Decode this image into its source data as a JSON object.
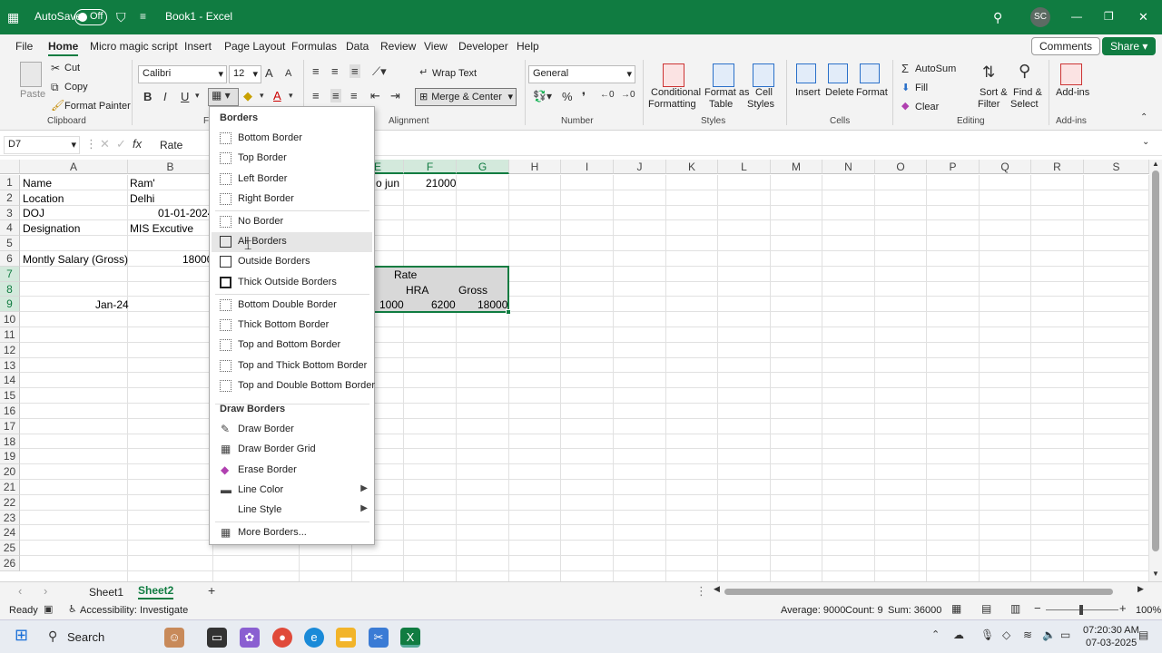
{
  "titlebar": {
    "autosave": "AutoSave",
    "autosave_state": "Off",
    "doc_title": "Book1 - Excel",
    "user_initials": "SC"
  },
  "menu": {
    "tabs": [
      "File",
      "Home",
      "Micro magic script",
      "Insert",
      "Page Layout",
      "Formulas",
      "Data",
      "Review",
      "View",
      "Developer",
      "Help"
    ],
    "comments": "Comments",
    "share": "Share"
  },
  "ribbon": {
    "cut": "Cut",
    "copy": "Copy",
    "format_painter": "Format Painter",
    "paste": "Paste",
    "clipboard": "Clipboard",
    "font_name": "Calibri",
    "font_size": "12",
    "font_group": "F",
    "wrap_text": "Wrap Text",
    "merge_center": "Merge & Center",
    "alignment": "Alignment",
    "number_format": "General",
    "number": "Number",
    "cond_fmt_1": "Conditional",
    "cond_fmt_2": "Formatting",
    "format_table_1": "Format as",
    "format_table_2": "Table",
    "cell_styles_1": "Cell",
    "cell_styles_2": "Styles",
    "styles": "Styles",
    "insert": "Insert",
    "delete": "Delete",
    "format": "Format",
    "cells": "Cells",
    "autosum": "AutoSum",
    "fill": "Fill",
    "clear": "Clear",
    "sort_1": "Sort &",
    "sort_2": "Filter",
    "find_1": "Find &",
    "find_2": "Select",
    "editing": "Editing",
    "addins": "Add-ins",
    "addins_group": "Add-ins"
  },
  "formula": {
    "namebox": "D7",
    "fx": "fx",
    "content": "Rate"
  },
  "columns": [
    "A",
    "B",
    "C",
    "D",
    "E",
    "F",
    "G",
    "H",
    "I",
    "J",
    "K",
    "L",
    "M",
    "N",
    "O",
    "P",
    "Q",
    "R",
    "S"
  ],
  "rows": [
    "1",
    "2",
    "3",
    "4",
    "5",
    "6",
    "7",
    "8",
    "9",
    "10",
    "11",
    "12",
    "13",
    "14",
    "15",
    "16",
    "17",
    "18",
    "19",
    "20",
    "21",
    "22",
    "23",
    "24",
    "25",
    "26"
  ],
  "cells": {
    "a1": "Name",
    "b1": "Ram'",
    "a2": "Location",
    "b2": "Delhi",
    "a3": "DOJ",
    "b3": "01-01-2024",
    "a4": "Designation",
    "b4": "MIS Excutive",
    "a6": "Montly Salary (Gross)",
    "b6": "18000",
    "a9": "Jan-24",
    "e1": "o jun",
    "f1": "21000",
    "rate": "Rate",
    "hra": "HRA",
    "gross": "Gross",
    "e9": "1000",
    "f9": "6200",
    "g9": "18000"
  },
  "borders_menu": {
    "header": "Borders",
    "items": [
      "Bottom Border",
      "Top Border",
      "Left Border",
      "Right Border",
      "No Border",
      "All Borders",
      "Outside Borders",
      "Thick Outside Borders",
      "Bottom Double Border",
      "Thick Bottom Border",
      "Top and Bottom Border",
      "Top and Thick Bottom Border",
      "Top and Double Bottom Border"
    ],
    "draw_header": "Draw Borders",
    "draw_items": [
      "Draw Border",
      "Draw Border Grid",
      "Erase Border",
      "Line Color",
      "Line Style",
      "More Borders..."
    ]
  },
  "sheets": [
    "Sheet1",
    "Sheet2"
  ],
  "status": {
    "ready": "Ready",
    "accessibility": "Accessibility: Investigate",
    "average": "Average: 9000",
    "count": "Count: 9",
    "sum": "Sum: 36000",
    "zoom": "100%"
  },
  "taskbar": {
    "search": "Search",
    "time": "07:20:30 AM",
    "date": "07-03-2025"
  }
}
